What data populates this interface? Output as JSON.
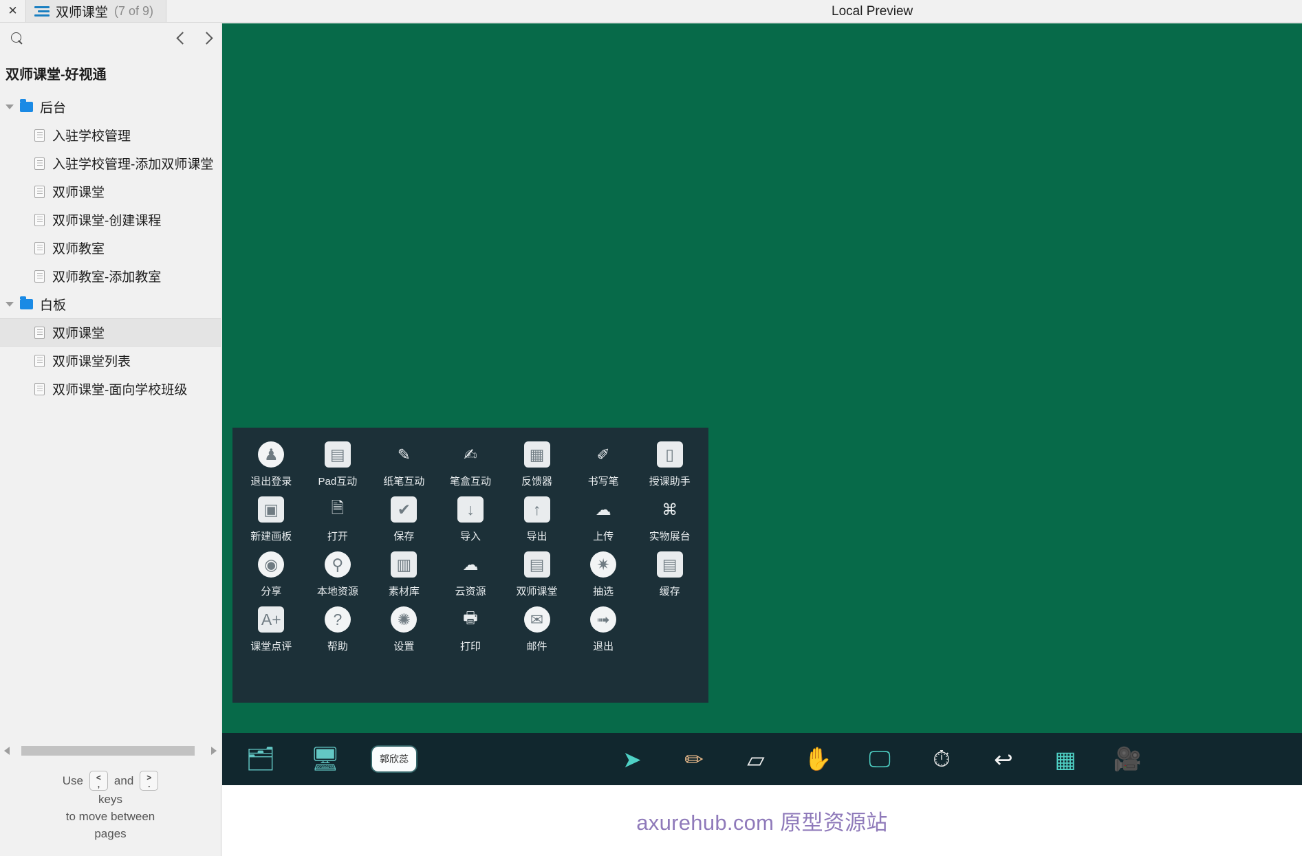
{
  "topbar": {
    "close_label": "✕",
    "tab_title": "双师课堂",
    "tab_count": "(7 of 9)",
    "preview_label": "Local Preview"
  },
  "sidebar": {
    "search_placeholder": "",
    "project_title": "双师课堂-好视通",
    "tree": [
      {
        "type": "folder",
        "label": "后台",
        "selected": false
      },
      {
        "type": "page",
        "label": "入驻学校管理",
        "selected": false
      },
      {
        "type": "page",
        "label": "入驻学校管理-添加双师课堂",
        "selected": false
      },
      {
        "type": "page",
        "label": "双师课堂",
        "selected": false
      },
      {
        "type": "page",
        "label": "双师课堂-创建课程",
        "selected": false
      },
      {
        "type": "page",
        "label": "双师教室",
        "selected": false
      },
      {
        "type": "page",
        "label": "双师教室-添加教室",
        "selected": false
      },
      {
        "type": "folder",
        "label": "白板",
        "selected": false
      },
      {
        "type": "page",
        "label": "双师课堂",
        "selected": true
      },
      {
        "type": "page",
        "label": "双师课堂列表",
        "selected": false
      },
      {
        "type": "page",
        "label": "双师课堂-面向学校班级",
        "selected": false
      }
    ],
    "hint": {
      "use": "Use",
      "and": "and",
      "key_left_top": "<",
      "key_left_bottom": ",",
      "key_right_top": ">",
      "key_right_bottom": ".",
      "line2": "keys",
      "line3": "to move between",
      "line4": "pages"
    }
  },
  "canvas": {
    "background_color": "#076a49",
    "panel_color": "#1c3038",
    "toolbar_color": "#11272e",
    "grid": [
      {
        "label": "退出登录",
        "icon": "logout-user-icon",
        "glyph": "♟",
        "style": "circle"
      },
      {
        "label": "Pad互动",
        "icon": "tablet-interaction-icon",
        "glyph": "▤",
        "style": "rounded"
      },
      {
        "label": "纸笔互动",
        "icon": "paper-pen-interaction-icon",
        "glyph": "✎",
        "style": "plain"
      },
      {
        "label": "笔盒互动",
        "icon": "pen-box-interaction-icon",
        "glyph": "✍",
        "style": "plain"
      },
      {
        "label": "反馈器",
        "icon": "responder-keypad-icon",
        "glyph": "▦",
        "style": "rounded"
      },
      {
        "label": "书写笔",
        "icon": "stylus-pen-icon",
        "glyph": "✐",
        "style": "plain"
      },
      {
        "label": "授课助手",
        "icon": "teaching-assistant-phone-icon",
        "glyph": "▯",
        "style": "rounded"
      },
      {
        "label": "新建画板",
        "icon": "new-canvas-icon",
        "glyph": "▣",
        "style": "rounded"
      },
      {
        "label": "打开",
        "icon": "open-file-icon",
        "glyph": "🗎",
        "style": "plain"
      },
      {
        "label": "保存",
        "icon": "save-check-icon",
        "glyph": "✔",
        "style": "rounded"
      },
      {
        "label": "导入",
        "icon": "import-down-arrow-icon",
        "glyph": "↓",
        "style": "rounded"
      },
      {
        "label": "导出",
        "icon": "export-up-arrow-icon",
        "glyph": "↑",
        "style": "rounded"
      },
      {
        "label": "上传",
        "icon": "cloud-upload-icon",
        "glyph": "☁",
        "style": "plain"
      },
      {
        "label": "实物展台",
        "icon": "document-camera-icon",
        "glyph": "⌘",
        "style": "plain"
      },
      {
        "label": "分享",
        "icon": "share-broadcast-icon",
        "glyph": "◉",
        "style": "circle"
      },
      {
        "label": "本地资源",
        "icon": "local-resource-pin-icon",
        "glyph": "⚲",
        "style": "circle"
      },
      {
        "label": "素材库",
        "icon": "material-library-icon",
        "glyph": "▥",
        "style": "rounded"
      },
      {
        "label": "云资源",
        "icon": "cloud-resource-icon",
        "glyph": "☁",
        "style": "plain"
      },
      {
        "label": "双师课堂",
        "icon": "dual-teacher-class-icon",
        "glyph": "▤",
        "style": "rounded"
      },
      {
        "label": "抽选",
        "icon": "random-pick-wheel-icon",
        "glyph": "✷",
        "style": "circle"
      },
      {
        "label": "缓存",
        "icon": "cache-server-icon",
        "glyph": "▤",
        "style": "rounded"
      },
      {
        "label": "课堂点评",
        "icon": "class-rating-icon",
        "glyph": "A+",
        "style": "rounded"
      },
      {
        "label": "帮助",
        "icon": "help-question-icon",
        "glyph": "?",
        "style": "circle"
      },
      {
        "label": "设置",
        "icon": "settings-gear-icon",
        "glyph": "✺",
        "style": "circle"
      },
      {
        "label": "打印",
        "icon": "printer-icon",
        "glyph": "🖶",
        "style": "plain"
      },
      {
        "label": "邮件",
        "icon": "mail-envelope-icon",
        "glyph": "✉",
        "style": "circle"
      },
      {
        "label": "退出",
        "icon": "exit-arrow-icon",
        "glyph": "➟",
        "style": "circle"
      }
    ],
    "toolbar_left": [
      {
        "icon": "documents-tray-icon",
        "glyph": "🗂"
      },
      {
        "icon": "desktop-windows-icon",
        "glyph": "🖥"
      }
    ],
    "user_chip": "郭欣蕊",
    "toolbar_right": [
      {
        "icon": "cursor-arrow-icon",
        "glyph": "➤"
      },
      {
        "icon": "pencil-icon",
        "glyph": "✏"
      },
      {
        "icon": "eraser-icon",
        "glyph": "▱"
      },
      {
        "icon": "hand-pan-icon",
        "glyph": "✋"
      },
      {
        "icon": "whiteboard-screen-icon",
        "glyph": "🖵"
      },
      {
        "icon": "stopwatch-timer-icon",
        "glyph": "⏱"
      },
      {
        "icon": "undo-arrow-icon",
        "glyph": "↩"
      },
      {
        "icon": "grid-apps-icon",
        "glyph": "▦"
      },
      {
        "icon": "video-camera-icon",
        "glyph": "🎥"
      }
    ]
  },
  "footer": {
    "watermark": "axurehub.com 原型资源站",
    "watermark_color": "#8f7aba"
  }
}
